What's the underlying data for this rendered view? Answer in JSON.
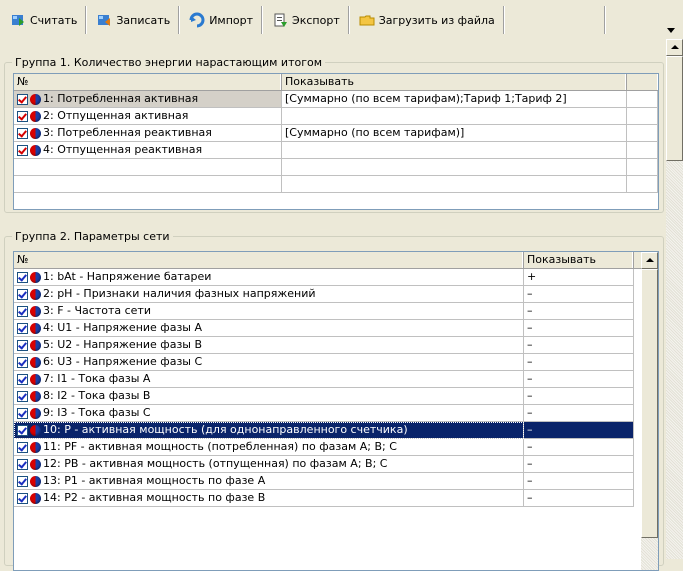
{
  "toolbar": {
    "buttons": [
      {
        "label": "Считать",
        "icon": "read-icon"
      },
      {
        "label": "Записать",
        "icon": "write-icon"
      },
      {
        "label": "Импорт",
        "icon": "import-icon"
      },
      {
        "label": "Экспорт",
        "icon": "export-icon"
      },
      {
        "label": "Загрузить из файла",
        "icon": "folder-icon"
      }
    ]
  },
  "group1": {
    "title": "Группа 1. Количество энергии нарастающим итогом",
    "columns": [
      "№",
      "Показывать"
    ],
    "rows": [
      {
        "name": "1: Потребленная активная",
        "show": "[Суммарно (по всем тарифам);Тариф 1;Тариф 2]"
      },
      {
        "name": "2: Отпущенная активная",
        "show": ""
      },
      {
        "name": "3: Потребленная реактивная",
        "show": "[Суммарно (по всем тарифам)]"
      },
      {
        "name": "4: Отпущенная реактивная",
        "show": ""
      }
    ]
  },
  "group2": {
    "title": "Группа 2. Параметры сети",
    "columns": [
      "№",
      "Показывать"
    ],
    "selected_index": 9,
    "rows": [
      {
        "name": "1: bAt - Напряжение батареи",
        "show": "+"
      },
      {
        "name": "2: pH - Признаки наличия фазных напряжений",
        "show": "–"
      },
      {
        "name": "3: F - Частота сети",
        "show": "–"
      },
      {
        "name": "4: U1 - Напряжение фазы А",
        "show": "–"
      },
      {
        "name": "5: U2 - Напряжение фазы В",
        "show": "–"
      },
      {
        "name": "6: U3 - Напряжение фазы С",
        "show": "–"
      },
      {
        "name": "7: I1 - Тока фазы А",
        "show": "–"
      },
      {
        "name": "8: I2 - Тока фазы В",
        "show": "–"
      },
      {
        "name": "9: I3 - Тока фазы С",
        "show": "–"
      },
      {
        "name": "10: P - активная мощность (для однонаправленного счетчика)",
        "show": "–"
      },
      {
        "name": "11: PF - активная мощность (потребленная) по фазам А; В; С",
        "show": "–"
      },
      {
        "name": "12: PB - активная мощность (отпущенная) по фазам А; В; С",
        "show": "–"
      },
      {
        "name": "13: P1 - активная мощность по фазе А",
        "show": "–"
      },
      {
        "name": "14: P2 - активная мощность по фазе В",
        "show": "–"
      }
    ]
  }
}
